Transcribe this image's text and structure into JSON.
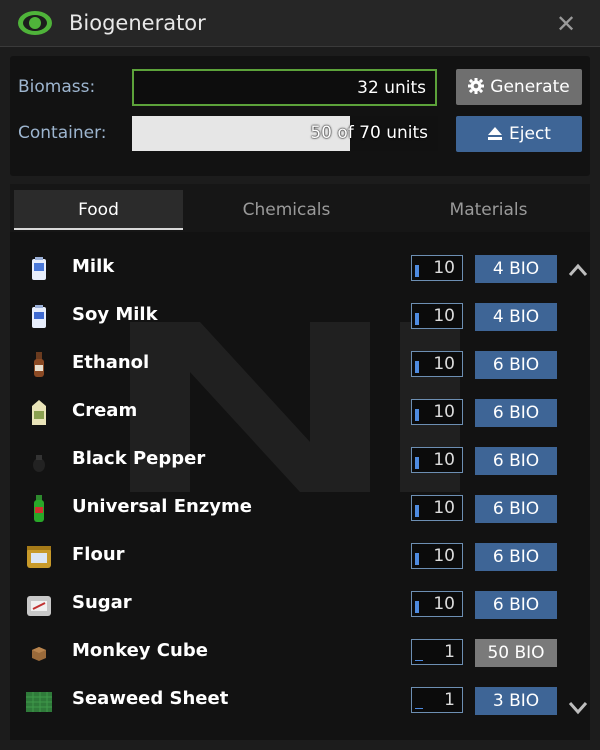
{
  "window": {
    "title": "Biogenerator",
    "close_label": "✕"
  },
  "status": {
    "biomass_label": "Biomass:",
    "biomass_value": "32 units",
    "container_label": "Container:",
    "container_value": "50 of 70 units",
    "container_fill_fraction": 0.714
  },
  "buttons": {
    "generate_label": "Generate",
    "eject_label": "Eject"
  },
  "tabs": [
    {
      "label": "Food",
      "active": true
    },
    {
      "label": "Chemicals",
      "active": false
    },
    {
      "label": "Materials",
      "active": false
    }
  ],
  "items": [
    {
      "name": "Milk",
      "qty": "10",
      "qty_fill_fraction": 0.6,
      "cost": "4 BIO",
      "enabled": true,
      "icon": "milk-carton-icon"
    },
    {
      "name": "Soy Milk",
      "qty": "10",
      "qty_fill_fraction": 0.6,
      "cost": "4 BIO",
      "enabled": true,
      "icon": "soy-milk-carton-icon"
    },
    {
      "name": "Ethanol",
      "qty": "10",
      "qty_fill_fraction": 0.6,
      "cost": "6 BIO",
      "enabled": true,
      "icon": "ethanol-bottle-icon"
    },
    {
      "name": "Cream",
      "qty": "10",
      "qty_fill_fraction": 0.6,
      "cost": "6 BIO",
      "enabled": true,
      "icon": "cream-carton-icon"
    },
    {
      "name": "Black Pepper",
      "qty": "10",
      "qty_fill_fraction": 0.6,
      "cost": "6 BIO",
      "enabled": true,
      "icon": "pepper-shaker-icon"
    },
    {
      "name": "Universal Enzyme",
      "qty": "10",
      "qty_fill_fraction": 0.6,
      "cost": "6 BIO",
      "enabled": true,
      "icon": "enzyme-bottle-icon"
    },
    {
      "name": "Flour",
      "qty": "10",
      "qty_fill_fraction": 0.6,
      "cost": "6 BIO",
      "enabled": true,
      "icon": "flour-bag-icon"
    },
    {
      "name": "Sugar",
      "qty": "10",
      "qty_fill_fraction": 0.6,
      "cost": "6 BIO",
      "enabled": true,
      "icon": "sugar-bag-icon"
    },
    {
      "name": "Monkey Cube",
      "qty": "1",
      "qty_fill_fraction": 0.0,
      "cost": "50 BIO",
      "enabled": false,
      "icon": "monkey-cube-icon"
    },
    {
      "name": "Seaweed Sheet",
      "qty": "1",
      "qty_fill_fraction": 0.0,
      "cost": "3 BIO",
      "enabled": true,
      "icon": "seaweed-sheet-icon"
    }
  ],
  "colors": {
    "accent_blue": "#3e6596",
    "biomass_border": "#5ca23a",
    "disabled_gray": "#7a7a7a"
  }
}
